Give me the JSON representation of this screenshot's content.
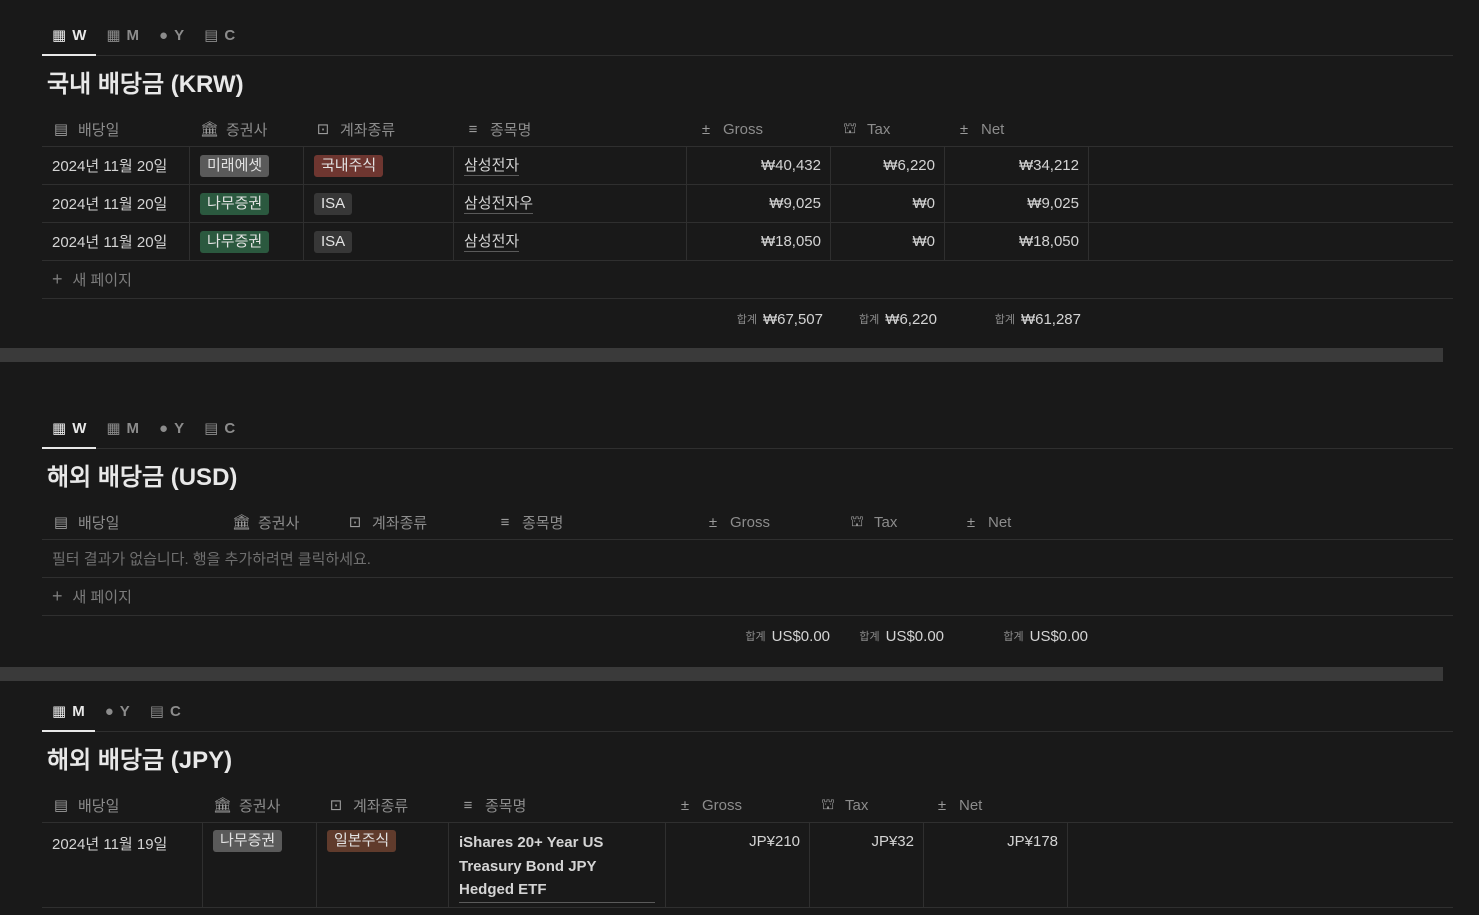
{
  "sections": {
    "krw": {
      "tabs": [
        {
          "icon": "calendar-week-icon",
          "label": "W"
        },
        {
          "icon": "calendar-month-icon",
          "label": "M"
        },
        {
          "icon": "circle-icon",
          "label": "Y"
        },
        {
          "icon": "calendar-icon",
          "label": "C"
        }
      ],
      "title": "국내 배당금 (KRW)",
      "headers": {
        "date": "배당일",
        "broker": "증권사",
        "account": "계좌종류",
        "name": "종목명",
        "gross": "Gross",
        "tax": "Tax",
        "net": "Net"
      },
      "rows": [
        {
          "date": "2024년 11월 20일",
          "broker": "미래에셋",
          "account": "국내주식",
          "name": "삼성전자",
          "gross": "₩40,432",
          "tax": "₩6,220",
          "net": "₩34,212"
        },
        {
          "date": "2024년 11월 20일",
          "broker": "나무증권",
          "account": "ISA",
          "name": "삼성전자우",
          "gross": "₩9,025",
          "tax": "₩0",
          "net": "₩9,025"
        },
        {
          "date": "2024년 11월 20일",
          "broker": "나무증권",
          "account": "ISA",
          "name": "삼성전자",
          "gross": "₩18,050",
          "tax": "₩0",
          "net": "₩18,050"
        }
      ],
      "new_page": "새 페이지",
      "sum_label": "합계",
      "sums": {
        "gross": "₩67,507",
        "tax": "₩6,220",
        "net": "₩61,287"
      }
    },
    "usd": {
      "tabs": [
        {
          "icon": "calendar-week-icon",
          "label": "W"
        },
        {
          "icon": "calendar-month-icon",
          "label": "M"
        },
        {
          "icon": "circle-icon",
          "label": "Y"
        },
        {
          "icon": "calendar-icon",
          "label": "C"
        }
      ],
      "title": "해외 배당금 (USD)",
      "headers": {
        "date": "배당일",
        "broker": "증권사",
        "account": "계좌종류",
        "name": "종목명",
        "gross": "Gross",
        "tax": "Tax",
        "net": "Net"
      },
      "empty_text": "필터 결과가 없습니다. 행을 추가하려면 클릭하세요.",
      "new_page": "새 페이지",
      "sum_label": "합계",
      "sums": {
        "gross": "US$0.00",
        "tax": "US$0.00",
        "net": "US$0.00"
      }
    },
    "jpy": {
      "tabs": [
        {
          "icon": "calendar-month-icon",
          "label": "M"
        },
        {
          "icon": "circle-icon",
          "label": "Y"
        },
        {
          "icon": "calendar-icon",
          "label": "C"
        }
      ],
      "title": "해외 배당금 (JPY)",
      "headers": {
        "date": "배당일",
        "broker": "증권사",
        "account": "계좌종류",
        "name": "종목명",
        "gross": "Gross",
        "tax": "Tax",
        "net": "Net"
      },
      "rows": [
        {
          "date": "2024년 11월 19일",
          "broker": "나무증권",
          "account": "일본주식",
          "name": "iShares 20+ Year US Treasury Bond JPY Hedged ETF",
          "gross": "JP¥210",
          "tax": "JP¥32",
          "net": "JP¥178"
        }
      ]
    }
  },
  "colors": {
    "background": "#191919",
    "tag_gray": "#5a5a5a",
    "tag_green": "#2b593f",
    "tag_red": "#6e3630",
    "tag_brown": "#603b2c",
    "tag_dark": "#373737"
  }
}
